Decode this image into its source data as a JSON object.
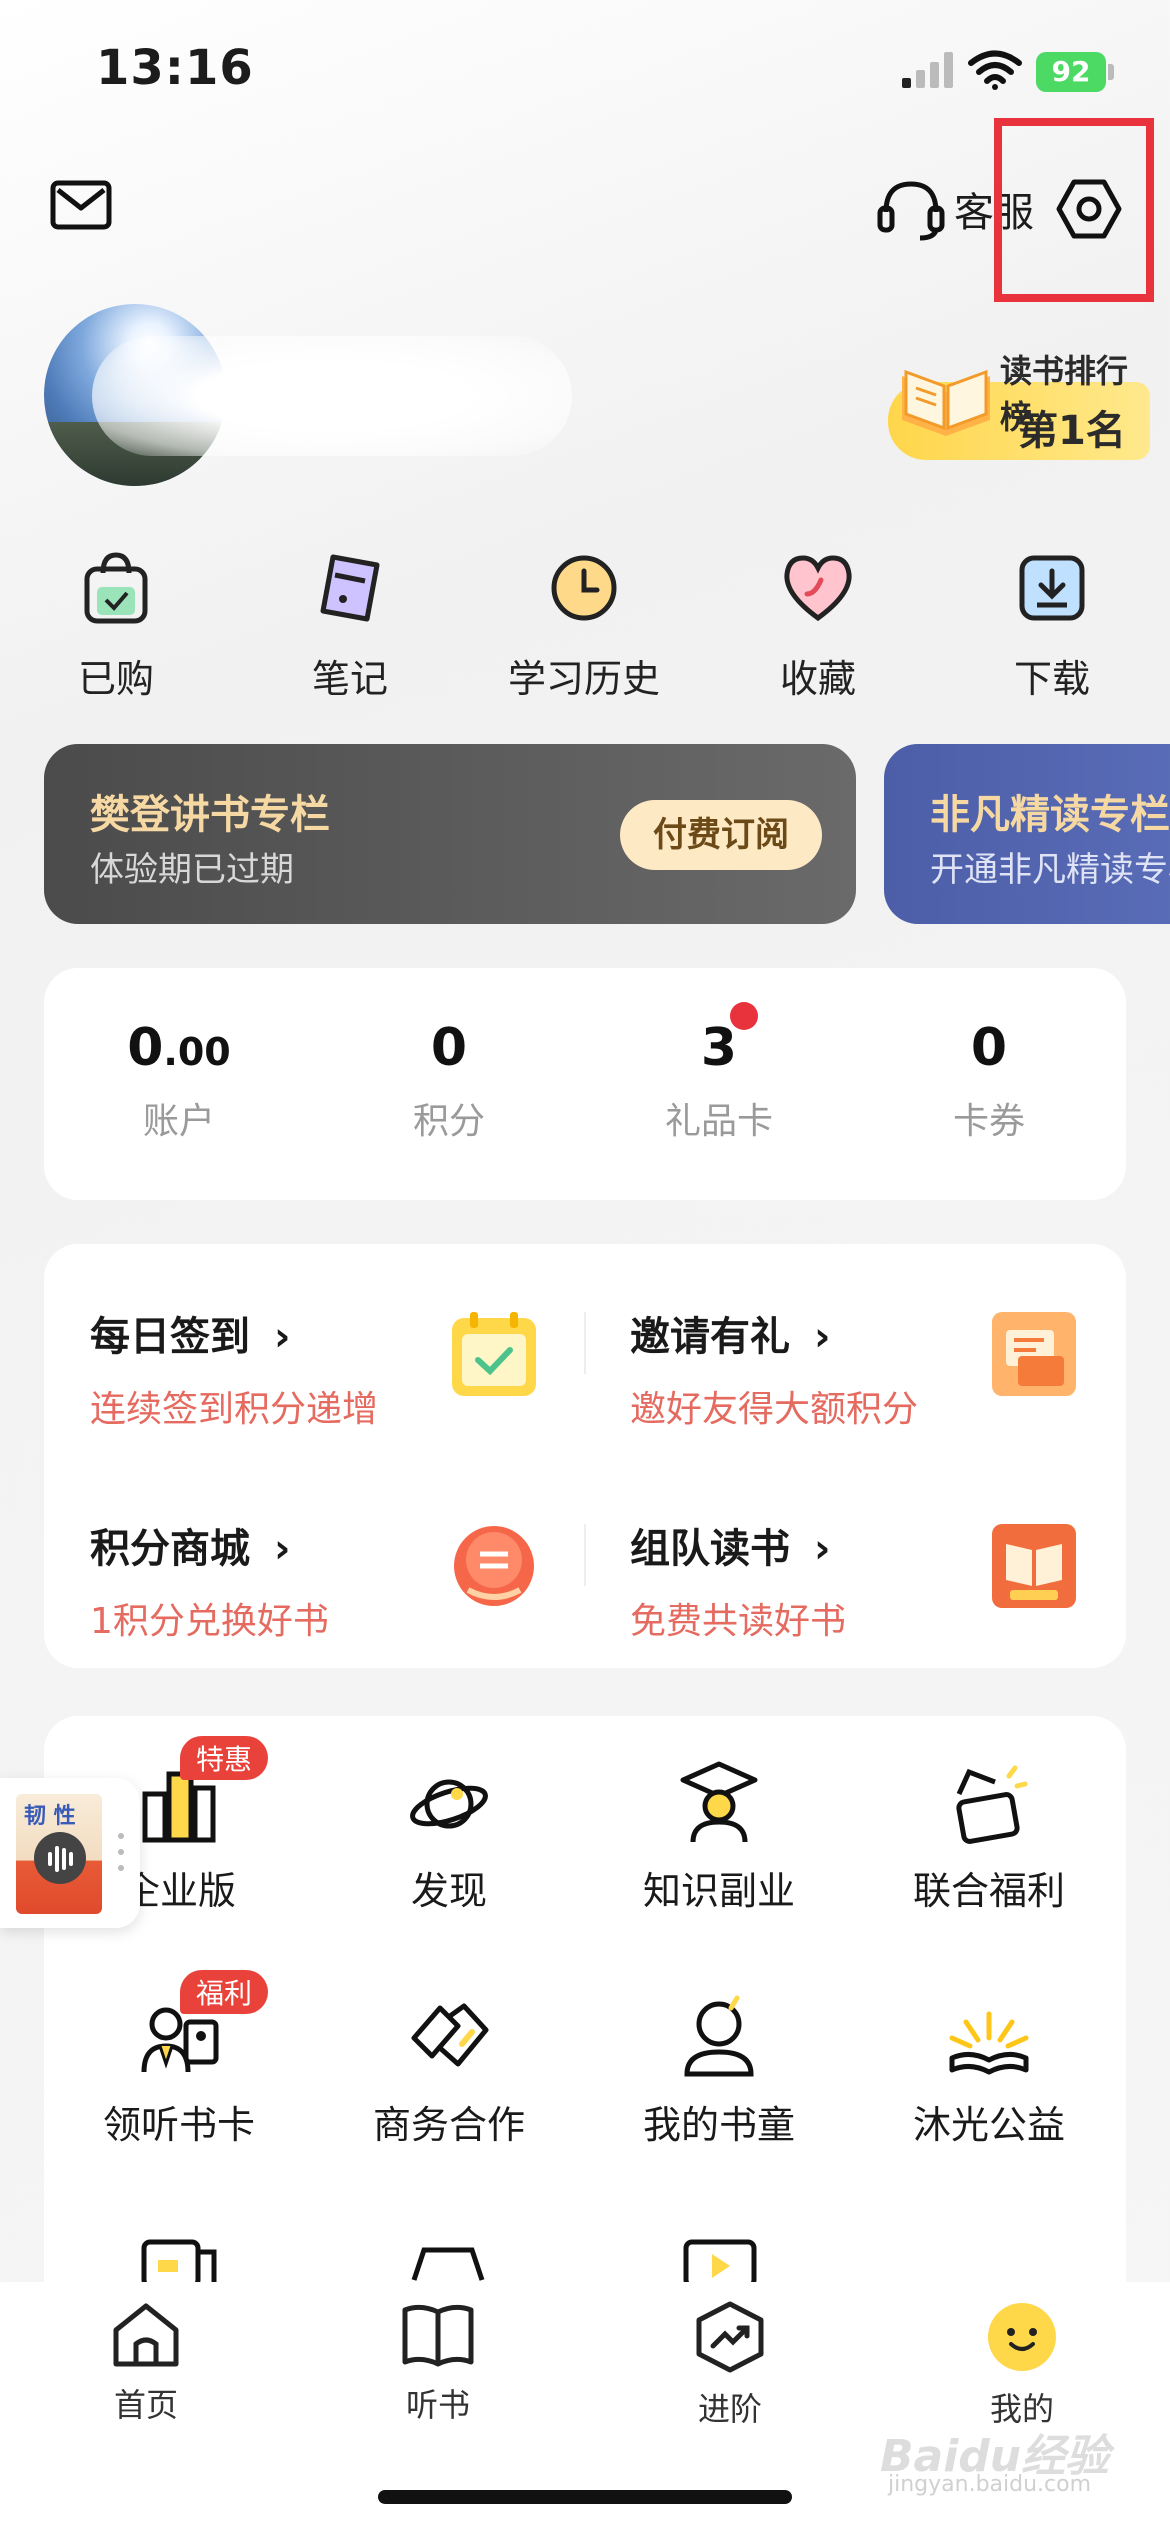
{
  "status_bar": {
    "time": "13:16",
    "battery": "92"
  },
  "header": {
    "customer_service": "客服"
  },
  "rank_badge": {
    "title": "读书排行榜",
    "value": "第1名"
  },
  "quick_actions": [
    {
      "label": "已购",
      "icon": "shopping-bag-icon"
    },
    {
      "label": "笔记",
      "icon": "note-icon"
    },
    {
      "label": "学习历史",
      "icon": "clock-icon"
    },
    {
      "label": "收藏",
      "icon": "heart-icon"
    },
    {
      "label": "下载",
      "icon": "download-icon"
    }
  ],
  "subscriptions": [
    {
      "title": "樊登讲书专栏",
      "subtitle": "体验期已过期",
      "button": "付费订阅"
    },
    {
      "title": "非凡精读专栏",
      "subtitle": "开通非凡精读专栏"
    }
  ],
  "stats": [
    {
      "value_main": "0",
      "value_decimal": ".00",
      "label": "账户"
    },
    {
      "value_main": "0",
      "value_decimal": "",
      "label": "积分"
    },
    {
      "value_main": "3",
      "value_decimal": "",
      "label": "礼品卡"
    },
    {
      "value_main": "0",
      "value_decimal": "",
      "label": "卡券"
    }
  ],
  "tasks": [
    {
      "title": "每日签到",
      "subtitle": "连续签到积分递增",
      "icon": "calendar-check-icon"
    },
    {
      "title": "邀请有礼",
      "subtitle": "邀好友得大额积分",
      "icon": "gift-invite-icon"
    },
    {
      "title": "积分商城",
      "subtitle": "1积分兑换好书",
      "icon": "mall-icon"
    },
    {
      "title": "组队读书",
      "subtitle": "免费共读好书",
      "icon": "team-book-icon"
    }
  ],
  "services": [
    {
      "label": "企业版",
      "badge": "特惠",
      "icon": "building-icon"
    },
    {
      "label": "发现",
      "badge": "",
      "icon": "planet-icon"
    },
    {
      "label": "知识副业",
      "badge": "",
      "icon": "graduate-icon"
    },
    {
      "label": "联合福利",
      "badge": "",
      "icon": "coupon-icon"
    },
    {
      "label": "领听书卡",
      "badge": "福利",
      "icon": "people-card-icon"
    },
    {
      "label": "商务合作",
      "badge": "",
      "icon": "handshake-icon"
    },
    {
      "label": "我的书童",
      "badge": "",
      "icon": "assistant-icon"
    },
    {
      "label": "沐光公益",
      "badge": "",
      "icon": "sunrise-book-icon"
    }
  ],
  "mini_player": {
    "title": "韧 性"
  },
  "bottom_nav": [
    {
      "label": "首页",
      "icon": "home-icon"
    },
    {
      "label": "听书",
      "icon": "book-icon"
    },
    {
      "label": "进阶",
      "icon": "trend-icon"
    },
    {
      "label": "我的",
      "icon": "smile-icon"
    }
  ],
  "watermark": {
    "text": "Baidu经验",
    "sub": "jingyan.baidu.com"
  }
}
